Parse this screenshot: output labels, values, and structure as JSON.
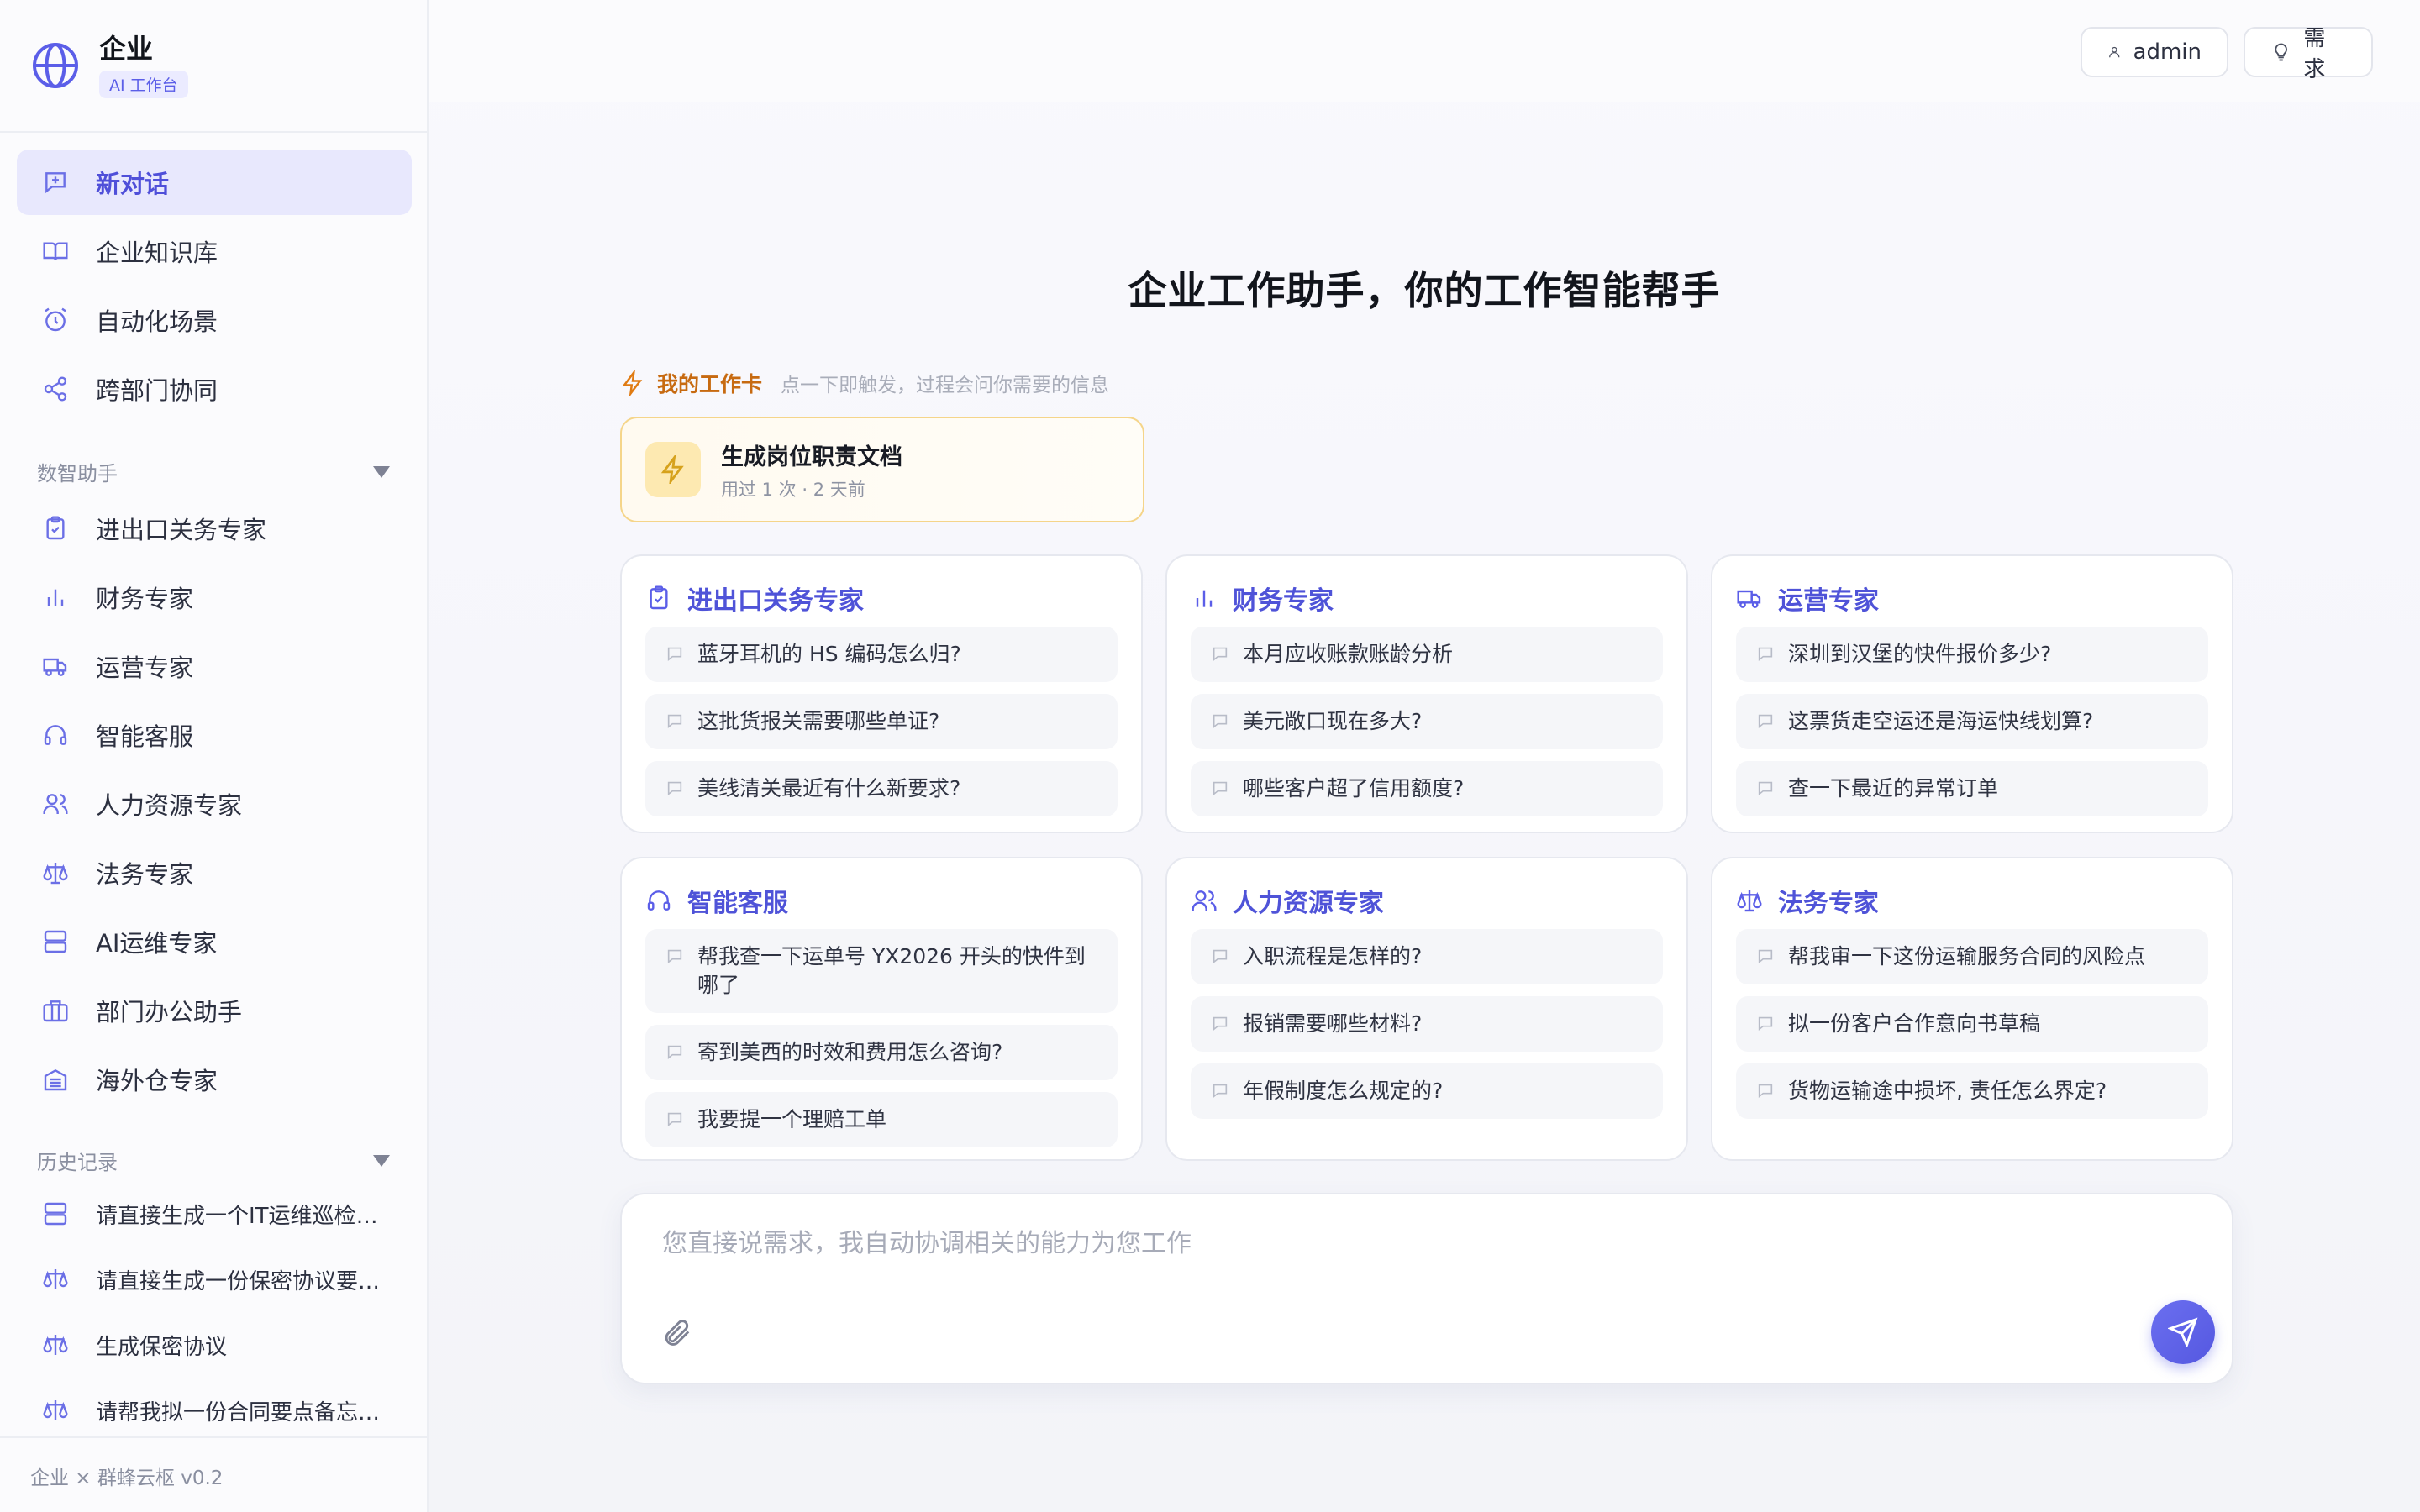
{
  "brand": {
    "name": "企业",
    "badge": "AI 工作台"
  },
  "nav": {
    "primary": [
      {
        "label": "新对话",
        "icon": "new-chat-icon"
      },
      {
        "label": "企业知识库",
        "icon": "book-icon"
      },
      {
        "label": "自动化场景",
        "icon": "alarm-clock-icon"
      },
      {
        "label": "跨部门协同",
        "icon": "share-icon"
      }
    ],
    "assistants_title": "数智助手",
    "assistants": [
      {
        "label": "进出口关务专家",
        "icon": "clipboard-check-icon"
      },
      {
        "label": "财务专家",
        "icon": "bar-chart-icon"
      },
      {
        "label": "运营专家",
        "icon": "truck-icon"
      },
      {
        "label": "智能客服",
        "icon": "headset-icon"
      },
      {
        "label": "人力资源专家",
        "icon": "users-icon"
      },
      {
        "label": "法务专家",
        "icon": "scale-icon"
      },
      {
        "label": "AI运维专家",
        "icon": "server-icon"
      },
      {
        "label": "部门办公助手",
        "icon": "briefcase-icon"
      },
      {
        "label": "海外仓专家",
        "icon": "warehouse-icon"
      }
    ],
    "history_title": "历史记录",
    "history": [
      {
        "label": "请直接生成一个IT运维巡检清...",
        "icon": "server-icon"
      },
      {
        "label": "请直接生成一份保密协议要点...",
        "icon": "scale-icon"
      },
      {
        "label": "生成保密协议",
        "icon": "scale-icon"
      },
      {
        "label": "请帮我拟一份合同要点备忘录...",
        "icon": "scale-icon"
      }
    ],
    "footer": "企业 × 群蜂云枢 v0.2"
  },
  "topbar": {
    "user_label": "admin",
    "request_label": "需求"
  },
  "hero": {
    "title": "企业工作助手，你的工作智能帮手"
  },
  "workcards": {
    "title": "我的工作卡",
    "hint": "点一下即触发，过程会问你需要的信息",
    "items": [
      {
        "title": "生成岗位职责文档",
        "meta": "用过 1 次 · 2 天前"
      }
    ]
  },
  "cards": [
    {
      "title": "进出口关务专家",
      "icon": "clipboard-check-icon",
      "questions": [
        "蓝牙耳机的 HS 编码怎么归?",
        "这批货报关需要哪些单证?",
        "美线清关最近有什么新要求?"
      ]
    },
    {
      "title": "财务专家",
      "icon": "bar-chart-icon",
      "questions": [
        "本月应收账款账龄分析",
        "美元敞口现在多大?",
        "哪些客户超了信用额度?"
      ]
    },
    {
      "title": "运营专家",
      "icon": "truck-icon",
      "questions": [
        "深圳到汉堡的快件报价多少?",
        "这票货走空运还是海运快线划算?",
        "查一下最近的异常订单"
      ]
    },
    {
      "title": "智能客服",
      "icon": "headset-icon",
      "questions": [
        "帮我查一下运单号 YX2026 开头的快件到哪了",
        "寄到美西的时效和费用怎么咨询?",
        "我要提一个理赔工单"
      ]
    },
    {
      "title": "人力资源专家",
      "icon": "users-icon",
      "questions": [
        "入职流程是怎样的?",
        "报销需要哪些材料?",
        "年假制度怎么规定的?"
      ]
    },
    {
      "title": "法务专家",
      "icon": "scale-icon",
      "questions": [
        "帮我审一下这份运输服务合同的风险点",
        "拟一份客户合作意向书草稿",
        "货物运输途中损坏, 责任怎么界定?"
      ]
    }
  ],
  "composer": {
    "placeholder": "您直接说需求，我自动协调相关的能力为您工作"
  },
  "colors": {
    "accent": "#5b5ee8",
    "warning": "#e07b12",
    "workcard_border": "#f5d58a"
  }
}
